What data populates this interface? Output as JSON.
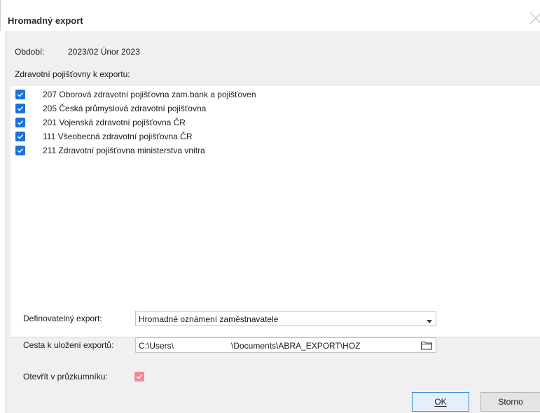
{
  "window": {
    "title": "Hromadný export",
    "close_icon": "close-icon"
  },
  "period": {
    "label": "Období:",
    "value": "2023/02 Únor 2023"
  },
  "insurers": {
    "label": "Zdravotní pojišťovny k exportu:",
    "items": [
      {
        "label": "207 Oborová zdravotní pojišťovna zam.bank a pojišťoven",
        "checked": true
      },
      {
        "label": "205 Česká průmyslová zdravotní pojišťovna",
        "checked": true
      },
      {
        "label": "201 Vojenská zdravotní pojišťovna ČR",
        "checked": true
      },
      {
        "label": "111 Všeobecná zdravotní pojišťovna ČR",
        "checked": true
      },
      {
        "label": "211 Zdravotní pojišťovna ministerstva vnitra",
        "checked": true
      }
    ]
  },
  "export_type": {
    "label": "Definovatelný export:",
    "value": "Hromadné oznámení zaměstnavatele"
  },
  "export_path": {
    "label": "Cesta k uložení exportů:",
    "value_part1": "C:\\Users\\",
    "value_part2": "\\Documents\\ABRA_EXPORT\\HOZ"
  },
  "open_explorer": {
    "label": "Otevřít v průzkumníku:",
    "checked": true
  },
  "buttons": {
    "ok": "OK",
    "cancel": "Storno"
  },
  "colors": {
    "checkbox_blue": "#1a73d6",
    "checkbox_pink": "#ee8a9a",
    "ok_border": "#2d86d9"
  }
}
